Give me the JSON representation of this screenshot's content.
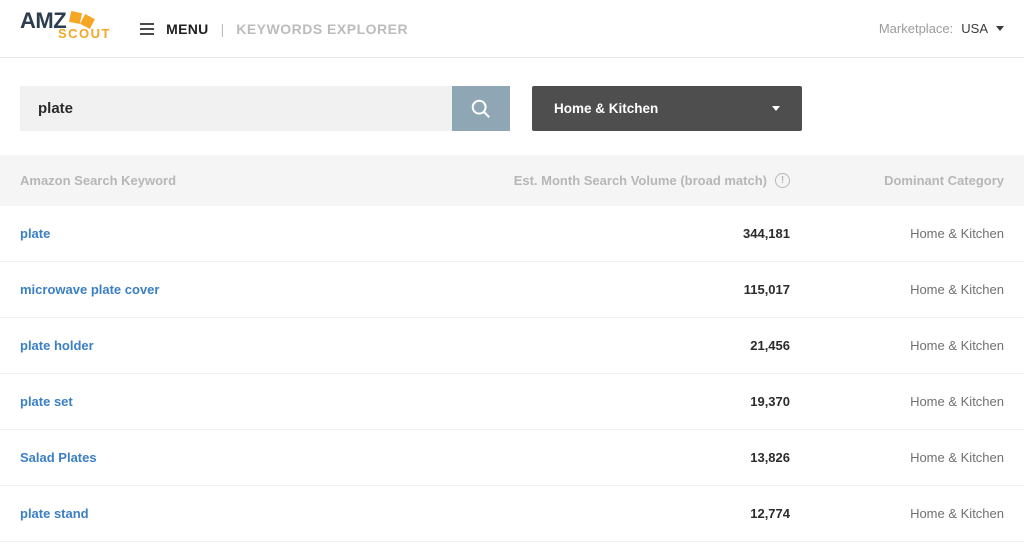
{
  "logo": {
    "amz": "AMZ",
    "scout": "SCOUT"
  },
  "nav": {
    "menu_label": "MENU",
    "divider": "|",
    "page_title": "KEYWORDS EXPLORER"
  },
  "marketplace": {
    "label": "Marketplace:",
    "value": "USA"
  },
  "search": {
    "value": "plate",
    "placeholder": ""
  },
  "category_select": {
    "selected": "Home & Kitchen"
  },
  "columns": {
    "keyword": "Amazon Search Keyword",
    "volume": "Est. Month Search Volume (broad match)",
    "category": "Dominant Category"
  },
  "rows": [
    {
      "keyword": "plate",
      "volume": "344,181",
      "category": "Home & Kitchen"
    },
    {
      "keyword": "microwave plate cover",
      "volume": "115,017",
      "category": "Home & Kitchen"
    },
    {
      "keyword": "plate holder",
      "volume": "21,456",
      "category": "Home & Kitchen"
    },
    {
      "keyword": "plate set",
      "volume": "19,370",
      "category": "Home & Kitchen"
    },
    {
      "keyword": "Salad Plates",
      "volume": "13,826",
      "category": "Home & Kitchen"
    },
    {
      "keyword": "plate stand",
      "volume": "12,774",
      "category": "Home & Kitchen"
    }
  ]
}
